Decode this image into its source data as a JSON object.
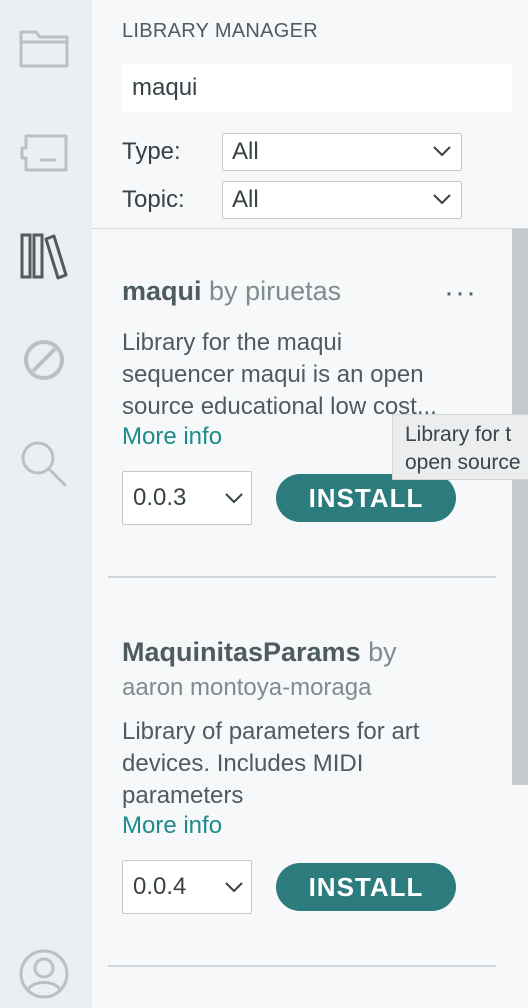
{
  "panel": {
    "title": "LIBRARY MANAGER",
    "search_value": "maqui",
    "filters": {
      "type_label": "Type:",
      "type_value": "All",
      "topic_label": "Topic:",
      "topic_value": "All"
    }
  },
  "activity_bar": {
    "icons": [
      "folder-icon",
      "board-icon",
      "library-icon",
      "debug-disabled-icon",
      "search-icon",
      "account-icon"
    ]
  },
  "libraries": [
    {
      "name": "maqui",
      "by": "by",
      "author": "piruetas",
      "description_line1": "Library for the maqui",
      "description_line2": "sequencer maqui is an open",
      "description_line3": "source educational low cost...",
      "more_info": "More info",
      "version": "0.0.3",
      "install": "INSTALL",
      "more_options": "···"
    },
    {
      "name": "MaquinitasParams",
      "by": "by",
      "author": "aaron montoya-moraga",
      "description_line1": "Library of parameters for art",
      "description_line2": "devices. Includes MIDI",
      "description_line3": "parameters",
      "more_info": "More info",
      "version": "0.0.4",
      "install": "INSTALL"
    }
  ],
  "tooltip": {
    "line1": "Library for t",
    "line2": "open source"
  },
  "colors": {
    "accent": "#2c7b7d",
    "link": "#1f8a8a",
    "activity_bg": "#eceff1",
    "panel_bg": "#f6f8f9"
  }
}
